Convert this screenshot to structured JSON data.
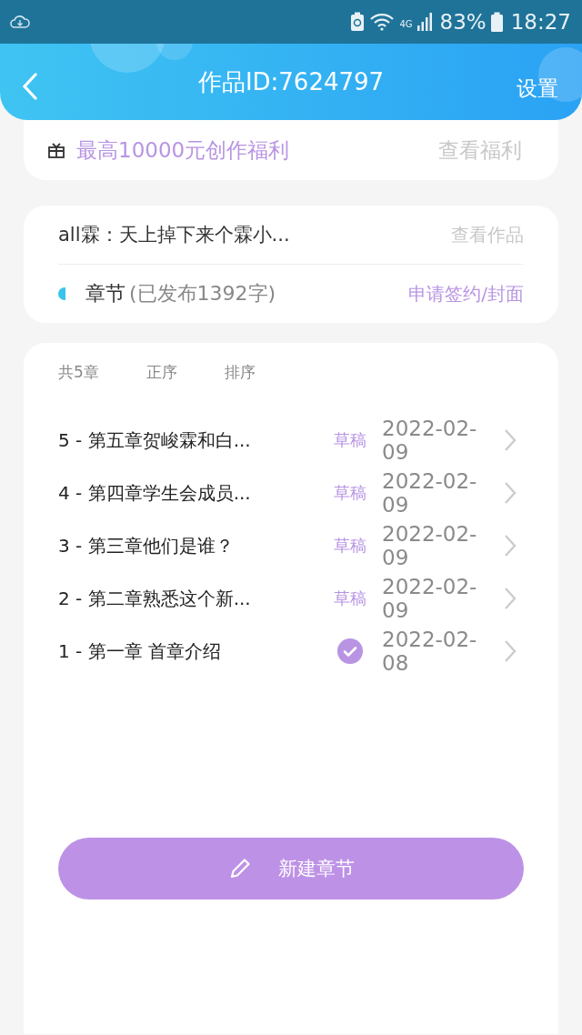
{
  "status_bar": {
    "network": "4G",
    "battery": "83%",
    "time": "18:27"
  },
  "header": {
    "title": "作品ID:7624797",
    "action": "设置"
  },
  "promo": {
    "text": "最高10000元创作福利",
    "link": "查看福利"
  },
  "work": {
    "title": "all霖：天上掉下来个霖小...",
    "link": "查看作品",
    "section": "章节",
    "count": "(已发布1392字)",
    "apply": "申请签约/封面"
  },
  "chapters": {
    "total": "共5章",
    "order": "正序",
    "sort": "排序",
    "items": [
      {
        "title": "5 - 第五章贺峻霖和白...",
        "kind": "draft",
        "label": "草稿",
        "date": "2022-02-09"
      },
      {
        "title": "4 - 第四章学生会成员...",
        "kind": "draft",
        "label": "草稿",
        "date": "2022-02-09"
      },
      {
        "title": "3 - 第三章他们是谁？",
        "kind": "draft",
        "label": "草稿",
        "date": "2022-02-09"
      },
      {
        "title": "2 - 第二章熟悉这个新...",
        "kind": "draft",
        "label": "草稿",
        "date": "2022-02-09"
      },
      {
        "title": "1 - 第一章  首章介绍",
        "kind": "published",
        "date": "2022-02-08"
      }
    ]
  },
  "new_button": "新建章节"
}
